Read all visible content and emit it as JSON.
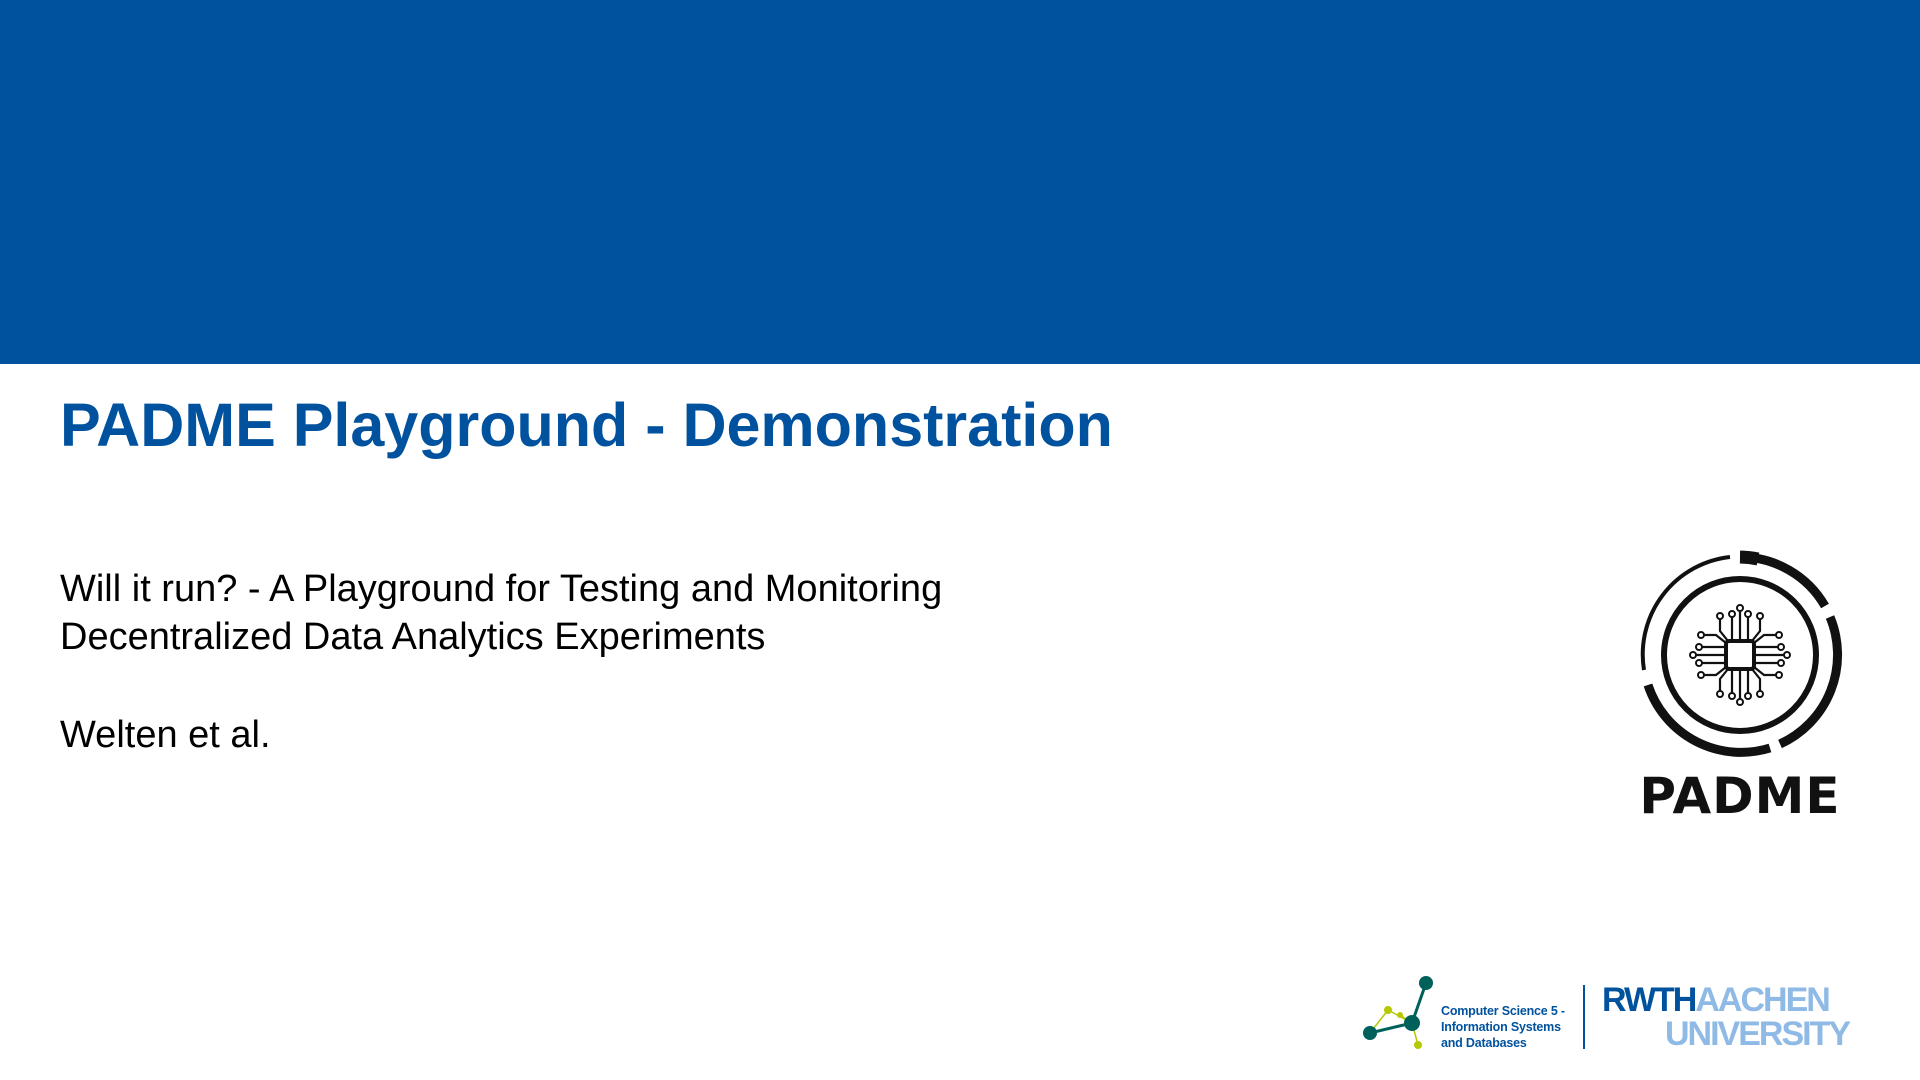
{
  "slide": {
    "title": "PADME Playground - Demonstration",
    "subtitle_lines": [
      "Will it run? - A Playground for Testing and Monitoring",
      "Decentralized Data Analytics Experiments"
    ],
    "authors": "Welten et al."
  },
  "padme_logo": {
    "wordmark": "PADME",
    "icon": "circuit-chip-icon"
  },
  "footer": {
    "cs5_icon": "network-graph-icon",
    "cs5_lines": [
      "Computer Science 5 -",
      "Information Systems",
      "and Databases"
    ],
    "rwth_strong": "RWTH",
    "rwth_light": "AACHEN",
    "rwth_line2": "UNIVERSITY"
  },
  "colors": {
    "brand_blue": "#00529f",
    "light_blue": "#8ebae5",
    "text": "#000000",
    "background": "#ffffff"
  }
}
